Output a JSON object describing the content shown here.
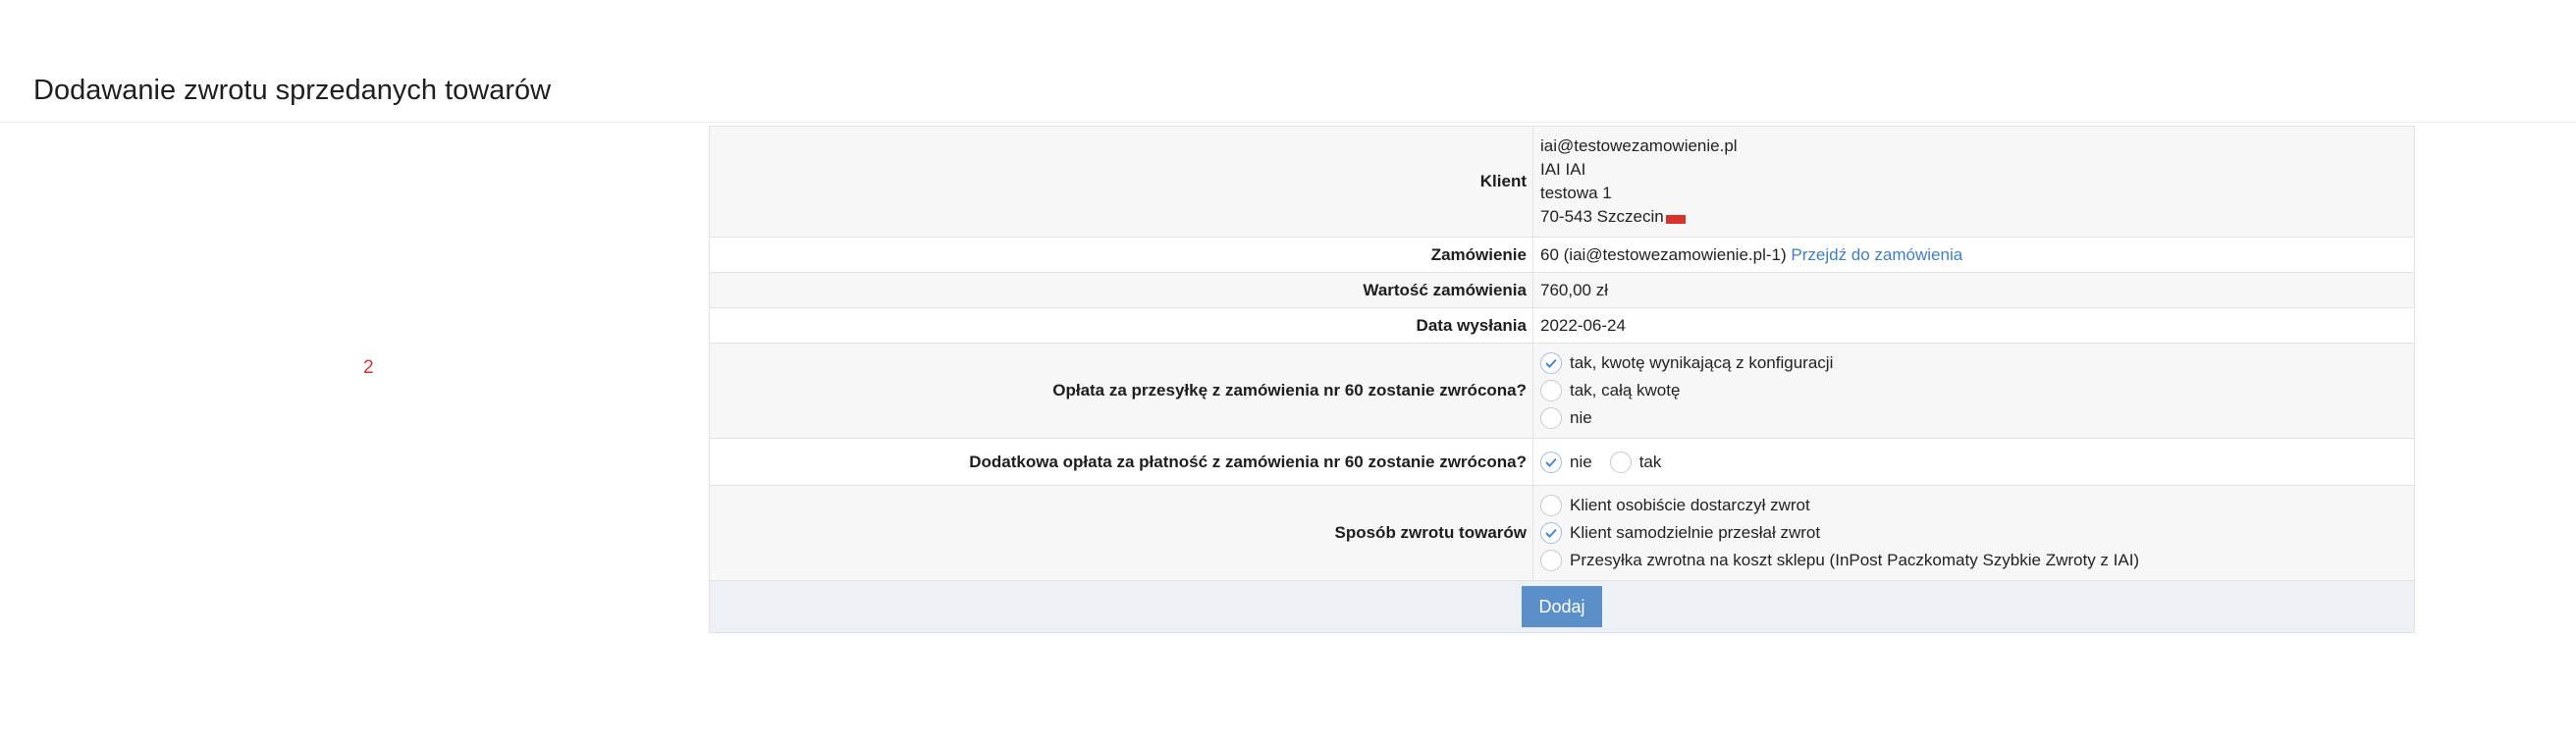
{
  "page": {
    "title": "Dodawanie zwrotu sprzedanych towarów",
    "side_number": "2"
  },
  "form": {
    "client": {
      "label": "Klient",
      "email": "iai@testowezamowienie.pl",
      "name": "IAI IAI",
      "street": "testowa 1",
      "city": "70-543 Szczecin"
    },
    "order": {
      "label": "Zamówienie",
      "text": "60 (iai@testowezamowienie.pl-1)",
      "link": "Przejdź do zamówienia"
    },
    "order_value": {
      "label": "Wartość zamówienia",
      "value": "760,00 zł"
    },
    "send_date": {
      "label": "Data wysłania",
      "value": "2022-06-24"
    },
    "shipping_fee": {
      "label": "Opłata za przesyłkę z zamówienia nr 60 zostanie zwrócona?",
      "options": [
        {
          "label": "tak, kwotę wynikającą z konfiguracji",
          "checked": true
        },
        {
          "label": "tak, całą kwotę",
          "checked": false
        },
        {
          "label": "nie",
          "checked": false
        }
      ]
    },
    "payment_fee": {
      "label": "Dodatkowa opłata za płatność z zamówienia nr 60 zostanie zwrócona?",
      "options": [
        {
          "label": "nie",
          "checked": true
        },
        {
          "label": "tak",
          "checked": false
        }
      ]
    },
    "return_method": {
      "label": "Sposób zwrotu towarów",
      "options": [
        {
          "label": "Klient osobiście dostarczył zwrot",
          "checked": false
        },
        {
          "label": "Klient samodzielnie przesłał zwrot",
          "checked": true
        },
        {
          "label": "Przesyłka zwrotna na koszt sklepu (InPost Paczkomaty Szybkie Zwroty z IAI)",
          "checked": false
        }
      ]
    },
    "submit_label": "Dodaj"
  },
  "colors": {
    "accent": "#5b8fca",
    "link": "#3f7fc4",
    "flag": "#d9332b",
    "side_number": "#d9332b"
  }
}
